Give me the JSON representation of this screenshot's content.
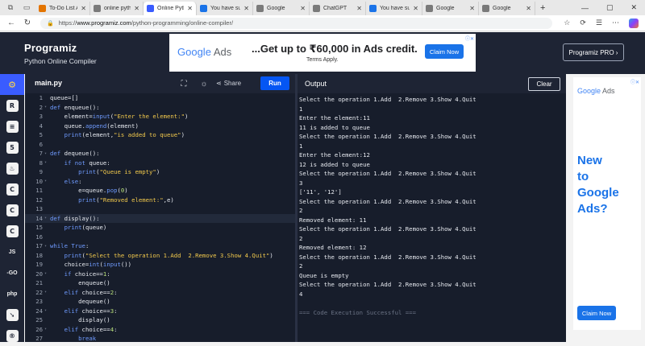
{
  "browser": {
    "tabs": [
      {
        "title": "To-Do List Ap",
        "favicon_color": "#e37400",
        "active": false
      },
      {
        "title": "online pytho",
        "favicon_color": "#7a7a7a",
        "active": false
      },
      {
        "title": "Online Pytho",
        "favicon_color": "#3a5cff",
        "active": true
      },
      {
        "title": "You have suc",
        "favicon_color": "#1a73e8",
        "active": false
      },
      {
        "title": "Google",
        "favicon_color": "#7a7a7a",
        "active": false
      },
      {
        "title": "ChatGPT",
        "favicon_color": "#7a7a7a",
        "active": false
      },
      {
        "title": "You have suc",
        "favicon_color": "#1a73e8",
        "active": false
      },
      {
        "title": "Google",
        "favicon_color": "#7a7a7a",
        "active": false
      },
      {
        "title": "Google",
        "favicon_color": "#7a7a7a",
        "active": false
      }
    ],
    "url_prefix": "https://",
    "url_host": "www.programiz.com",
    "url_path": "/python-programming/online-compiler/"
  },
  "header": {
    "logo": "Programiz",
    "subtitle": "Python Online Compiler",
    "pro_button": "Programiz PRO ›"
  },
  "ad_banner": {
    "brand": "Google",
    "brand_suffix": " Ads",
    "headline": "...Get up to ₹60,000 in Ads credit.",
    "subline": "Terms Apply.",
    "cta": "Claim Now"
  },
  "sidebar": {
    "items": [
      "python",
      "r",
      "sql",
      "html",
      "java",
      "c",
      "cpp",
      "csharp",
      "JS",
      "go",
      "php",
      "swift",
      "rust"
    ]
  },
  "editor": {
    "filename": "main.py",
    "share_label": "Share",
    "run_label": "Run",
    "lines": [
      {
        "n": "1",
        "fold": false,
        "html": "queue=[]"
      },
      {
        "n": "2",
        "fold": true,
        "html": "<span class='k'>def</span> enqueue():"
      },
      {
        "n": "3",
        "fold": false,
        "html": "    element=<span class='k'>input</span>(<span class='s'>\"Enter the element:\"</span>)"
      },
      {
        "n": "4",
        "fold": false,
        "html": "    queue.<span class='k'>append</span>(element)"
      },
      {
        "n": "5",
        "fold": false,
        "html": "    <span class='k'>print</span>(element,<span class='s'>\"is added to queue\"</span>)"
      },
      {
        "n": "6",
        "fold": false,
        "html": ""
      },
      {
        "n": "7",
        "fold": true,
        "html": "<span class='k'>def</span> dequeue():"
      },
      {
        "n": "8",
        "fold": true,
        "html": "    <span class='k'>if not</span> queue:"
      },
      {
        "n": "9",
        "fold": false,
        "html": "        <span class='k'>print</span>(<span class='s'>\"Queue is empty\"</span>)"
      },
      {
        "n": "10",
        "fold": true,
        "html": "    <span class='k'>else</span>:"
      },
      {
        "n": "11",
        "fold": false,
        "html": "        e=queue.<span class='k'>pop</span>(<span class='n'>0</span>)"
      },
      {
        "n": "12",
        "fold": false,
        "html": "        <span class='k'>print</span>(<span class='s'>\"Removed element:\"</span>,e)"
      },
      {
        "n": "13",
        "fold": false,
        "html": ""
      },
      {
        "n": "14",
        "fold": true,
        "html": "<span class='k'>def</span> display():",
        "highlight": true
      },
      {
        "n": "15",
        "fold": false,
        "html": "    <span class='k'>print</span>(queue)"
      },
      {
        "n": "16",
        "fold": false,
        "html": ""
      },
      {
        "n": "17",
        "fold": true,
        "html": "<span class='k'>while</span> <span class='k'>True</span>:"
      },
      {
        "n": "18",
        "fold": false,
        "html": "    <span class='k'>print</span>(<span class='s'>\"Select the operation 1.Add  2.Remove 3.Show 4.Quit\"</span>)"
      },
      {
        "n": "19",
        "fold": false,
        "html": "    choice=<span class='k'>int</span>(<span class='k'>input</span>())"
      },
      {
        "n": "20",
        "fold": true,
        "html": "    <span class='k'>if</span> choice==<span class='n'>1</span>:"
      },
      {
        "n": "21",
        "fold": false,
        "html": "        enqueue()"
      },
      {
        "n": "22",
        "fold": true,
        "html": "    <span class='k'>elif</span> choice==<span class='n'>2</span>:"
      },
      {
        "n": "23",
        "fold": false,
        "html": "        dequeue()"
      },
      {
        "n": "24",
        "fold": true,
        "html": "    <span class='k'>elif</span> choice==<span class='n'>3</span>:"
      },
      {
        "n": "25",
        "fold": false,
        "html": "        display()"
      },
      {
        "n": "26",
        "fold": true,
        "html": "    <span class='k'>elif</span> choice==<span class='n'>4</span>:"
      },
      {
        "n": "27",
        "fold": false,
        "html": "        <span class='k'>break</span>"
      }
    ]
  },
  "output": {
    "title": "Output",
    "clear_label": "Clear",
    "lines": [
      "Select the operation 1.Add  2.Remove 3.Show 4.Quit",
      "1",
      "Enter the element:11",
      "11 is added to queue",
      "Select the operation 1.Add  2.Remove 3.Show 4.Quit",
      "1",
      "Enter the element:12",
      "12 is added to queue",
      "Select the operation 1.Add  2.Remove 3.Show 4.Quit",
      "3",
      "['11', '12']",
      "Select the operation 1.Add  2.Remove 3.Show 4.Quit",
      "2",
      "Removed element: 11",
      "Select the operation 1.Add  2.Remove 3.Show 4.Quit",
      "2",
      "Removed element: 12",
      "Select the operation 1.Add  2.Remove 3.Show 4.Quit",
      "2",
      "Queue is empty",
      "Select the operation 1.Add  2.Remove 3.Show 4.Quit",
      "4",
      "",
      "=== Code Execution Successful ==="
    ]
  },
  "side_ad": {
    "brand": "Google",
    "brand_suffix": " Ads",
    "headline_lines": [
      "New",
      "to",
      "Google",
      "Ads?"
    ],
    "cta": "Claim Now"
  },
  "colors": {
    "header_bg": "#1e2434",
    "editor_bg": "#171d2b",
    "run_button": "#0556f3",
    "keyword": "#6f9bff",
    "string": "#f2c94c"
  }
}
